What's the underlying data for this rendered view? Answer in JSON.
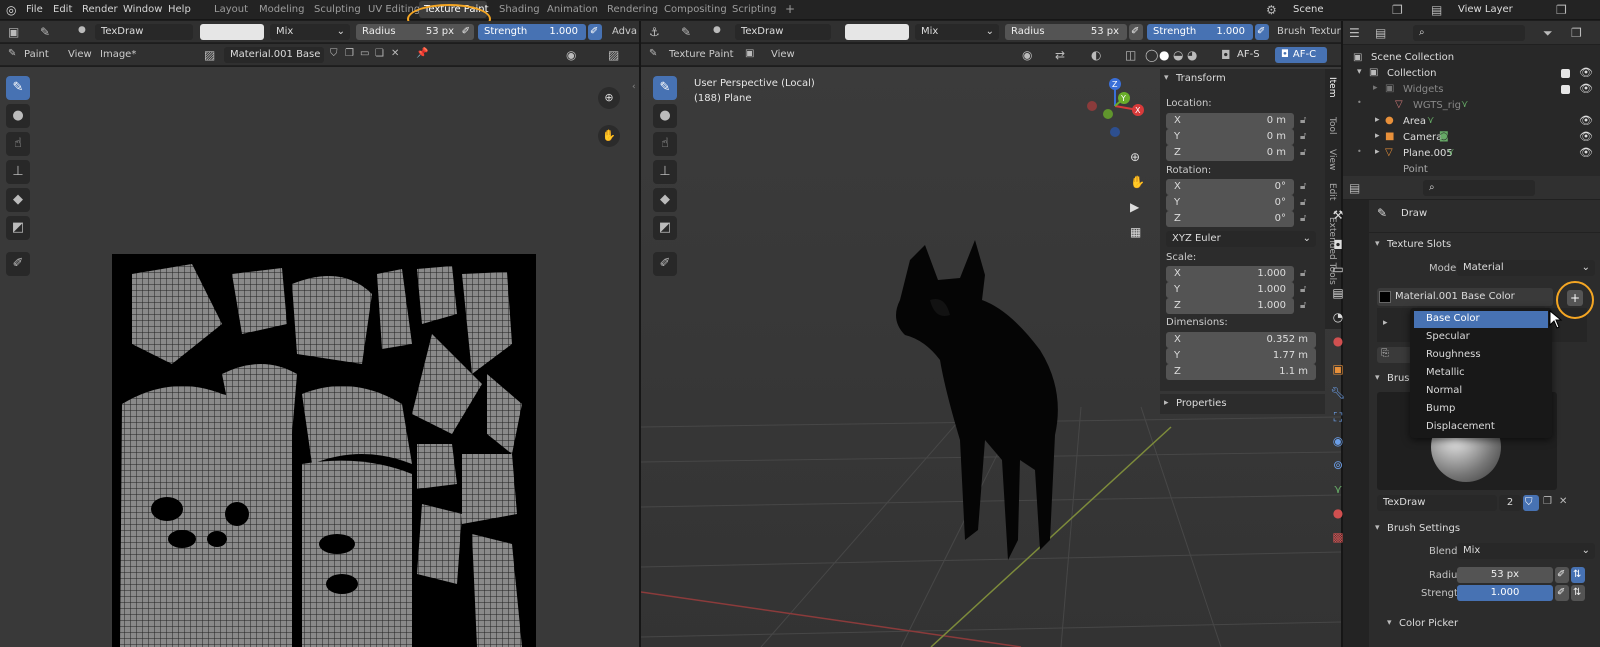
{
  "topbar": {
    "menus": [
      "File",
      "Edit",
      "Render",
      "Window",
      "Help"
    ],
    "workspaces": [
      "Layout",
      "Modeling",
      "Sculpting",
      "UV Editing",
      "Texture Paint",
      "Shading",
      "Animation",
      "Rendering",
      "Compositing",
      "Scripting"
    ],
    "add_tab": "+",
    "scene": "Scene",
    "view_layer": "View Layer"
  },
  "uv_editor": {
    "tool_brush": "TexDraw",
    "blend": "Mix",
    "radius_label": "Radius",
    "radius_value": "53 px",
    "strength_label": "Strength",
    "strength_value": "1.000",
    "adv_label": "Adva",
    "menu_paint": "Paint",
    "menu_view": "View",
    "menu_image": "Image*",
    "image_name": "Material.001 Base ..."
  },
  "viewport": {
    "tool_brush": "TexDraw",
    "blend": "Mix",
    "radius_label": "Radius",
    "radius_value": "53 px",
    "strength_label": "Strength",
    "strength_value": "1.000",
    "brush_menu": "Brush",
    "texture_menu": "Textur",
    "mode": "Texture Paint",
    "menu_view": "View",
    "perspective": "User Perspective (Local)",
    "object": "(188) Plane",
    "af_s": "AF-S",
    "af_c": "AF-C"
  },
  "n_panel": {
    "transform_title": "Transform",
    "location_label": "Location:",
    "location": [
      {
        "axis": "X",
        "value": "0 m"
      },
      {
        "axis": "Y",
        "value": "0 m"
      },
      {
        "axis": "Z",
        "value": "0 m"
      }
    ],
    "rotation_label": "Rotation:",
    "rotation": [
      {
        "axis": "X",
        "value": "0°"
      },
      {
        "axis": "Y",
        "value": "0°"
      },
      {
        "axis": "Z",
        "value": "0°"
      }
    ],
    "rotation_mode": "XYZ Euler",
    "scale_label": "Scale:",
    "scale": [
      {
        "axis": "X",
        "value": "1.000"
      },
      {
        "axis": "Y",
        "value": "1.000"
      },
      {
        "axis": "Z",
        "value": "1.000"
      }
    ],
    "dimensions_label": "Dimensions:",
    "dimensions": [
      {
        "axis": "X",
        "value": "0.352 m"
      },
      {
        "axis": "Y",
        "value": "1.77 m"
      },
      {
        "axis": "Z",
        "value": "1.1 m"
      }
    ],
    "properties_title": "Properties",
    "tabs": [
      "Item",
      "Tool",
      "View",
      "Edit",
      "Extended Tools"
    ]
  },
  "outliner": {
    "scene_collection": "Scene Collection",
    "items": [
      {
        "name": "Collection",
        "indent": 1
      },
      {
        "name": "Widgets",
        "indent": 2
      },
      {
        "name": "WGTS_rig",
        "indent": 3
      },
      {
        "name": "Area",
        "indent": 2
      },
      {
        "name": "Camera",
        "indent": 2
      },
      {
        "name": "Plane.005",
        "indent": 2
      },
      {
        "name": "Point",
        "indent": 2
      }
    ]
  },
  "properties": {
    "active_tool": "Draw",
    "texture_slots_title": "Texture Slots",
    "mode_label": "Mode",
    "mode_value": "Material",
    "slot_name": "Material.001 Base Color",
    "add_button": "+",
    "brushes_title": "Brushes",
    "brush_name": "TexDraw",
    "brush_users": "2",
    "brush_settings_title": "Brush Settings",
    "blend_label": "Blend",
    "blend_value": "Mix",
    "radius_label": "Radius",
    "radius_value": "53 px",
    "strength_label": "Strength",
    "strength_value": "1.000",
    "color_picker": "Color Picker"
  },
  "add_slot_menu": {
    "items": [
      "Base Color",
      "Specular",
      "Roughness",
      "Metallic",
      "Normal",
      "Bump",
      "Displacement"
    ],
    "selected": "Base Color"
  },
  "colors": {
    "accent": "#4772b3",
    "annotation": "#f5a623"
  }
}
